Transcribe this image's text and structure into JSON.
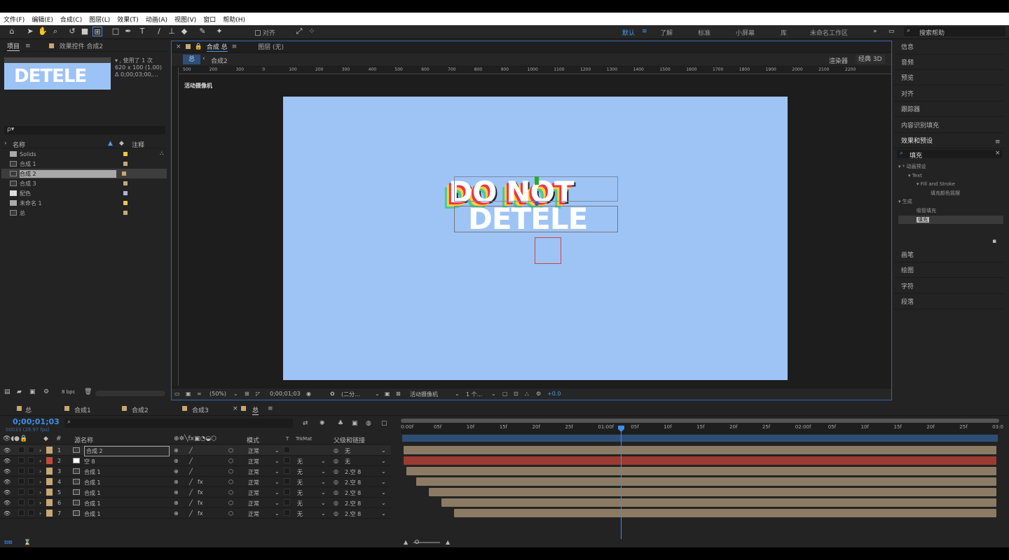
{
  "menu": [
    "文件(F)",
    "编辑(E)",
    "合成(C)",
    "图层(L)",
    "效果(T)",
    "动画(A)",
    "视图(V)",
    "窗口",
    "帮助(H)"
  ],
  "toolbar": {
    "align_label": "对齐",
    "workspaces": [
      "默认",
      "了解",
      "标准",
      "小屏幕",
      "库",
      "未命名工作区"
    ],
    "search": "搜索帮助"
  },
  "project": {
    "tab": "项目",
    "effects_tab": "效果控件 合成2",
    "info_line1": "▾ , 使用了 1 次",
    "info_line2": "620 x 100 (1.00)",
    "info_line3": "Δ 0;00;03;00,...",
    "thumb_text": "DETELE",
    "search_ph": "ρ▾",
    "col_name": "名称",
    "col_comment": "注释",
    "items": [
      {
        "label": "Solids",
        "color": "#e8c84a"
      },
      {
        "label": "合成 1",
        "color": "#c8a878"
      },
      {
        "label": "合成 2",
        "color": "#c8a878"
      },
      {
        "label": "合成 3",
        "color": "#c8a878"
      },
      {
        "label": "配色",
        "color": "#a8b8d8"
      },
      {
        "label": "未命名 1",
        "color": "#e8c84a"
      },
      {
        "label": "总",
        "color": "#c8a878"
      }
    ],
    "bpc": "8 bpc"
  },
  "comp": {
    "tab": "合成 总",
    "layer_tab": "图层 (无)",
    "crumb1": "总",
    "crumb2": "合成2",
    "renderer": "渲染器",
    "classic3d": "经典 3D",
    "camera": "活动摄像机",
    "title1": "DO NOT",
    "title2": "DETELE",
    "ruler_labels": [
      "500",
      "200",
      "300",
      "0",
      "100",
      "200",
      "300",
      "400",
      "500",
      "600",
      "700",
      "800",
      "900",
      "1000",
      "1100",
      "1200",
      "1300",
      "1400",
      "1500",
      "1600",
      "1700",
      "1800",
      "1900",
      "2000",
      "2100",
      "2200"
    ],
    "zoom": "(50%)",
    "time": "0;00;01;03",
    "res": "(二分...",
    "view": "活动摄像机",
    "views": "1 个...",
    "offset": "+0.0"
  },
  "right": {
    "items": [
      "信息",
      "音频",
      "预览",
      "对齐",
      "跟踪器",
      "内容识别填充",
      "效果和预设"
    ],
    "search": "填充",
    "tree": [
      "▾ * 动画预设",
      "▾ Text",
      "▾ Fill and Stroke",
      "填充颜色摇摆",
      "▾ 生成",
      "吸管填充",
      "填充"
    ],
    "more": [
      "画笔",
      "绘图",
      "字符",
      "段落"
    ]
  },
  "timeline": {
    "tabs": [
      "总",
      "合成1",
      "合成2",
      "合成3",
      "总"
    ],
    "timecode": "0;00;01;03",
    "fps": "00033 (29.97 fps)",
    "headers": {
      "name": "源名称",
      "mode": "模式",
      "t": "T",
      "trkmat": "TrkMat",
      "parent": "父级和链接"
    },
    "ticks": [
      "0:00f",
      "05f",
      "10f",
      "15f",
      "20f",
      "25f",
      "01:00f",
      "05f",
      "10f",
      "15f",
      "20f",
      "25f",
      "02:00f",
      "05f",
      "10f",
      "15f",
      "20f",
      "25f",
      "03:0"
    ],
    "layers": [
      {
        "num": "1",
        "name": "合成 2",
        "mode": "正常",
        "trk": "",
        "parent": "无",
        "color": "#c7a873"
      },
      {
        "num": "2",
        "name": "空 8",
        "mode": "正常",
        "trk": "无",
        "parent": "无",
        "color": "#c24a3c"
      },
      {
        "num": "3",
        "name": "合成 1",
        "mode": "正常",
        "trk": "无",
        "parent": "2.空 8",
        "color": "#c7a873"
      },
      {
        "num": "4",
        "name": "合成 1",
        "mode": "正常",
        "trk": "无",
        "parent": "2.空 8",
        "color": "#c7a873"
      },
      {
        "num": "5",
        "name": "合成 1",
        "mode": "正常",
        "trk": "无",
        "parent": "2.空 8",
        "color": "#c7a873"
      },
      {
        "num": "6",
        "name": "合成 1",
        "mode": "正常",
        "trk": "无",
        "parent": "2.空 8",
        "color": "#c7a873"
      },
      {
        "num": "7",
        "name": "合成 1",
        "mode": "正常",
        "trk": "无",
        "parent": "2.空 8",
        "color": "#c7a873"
      }
    ]
  }
}
